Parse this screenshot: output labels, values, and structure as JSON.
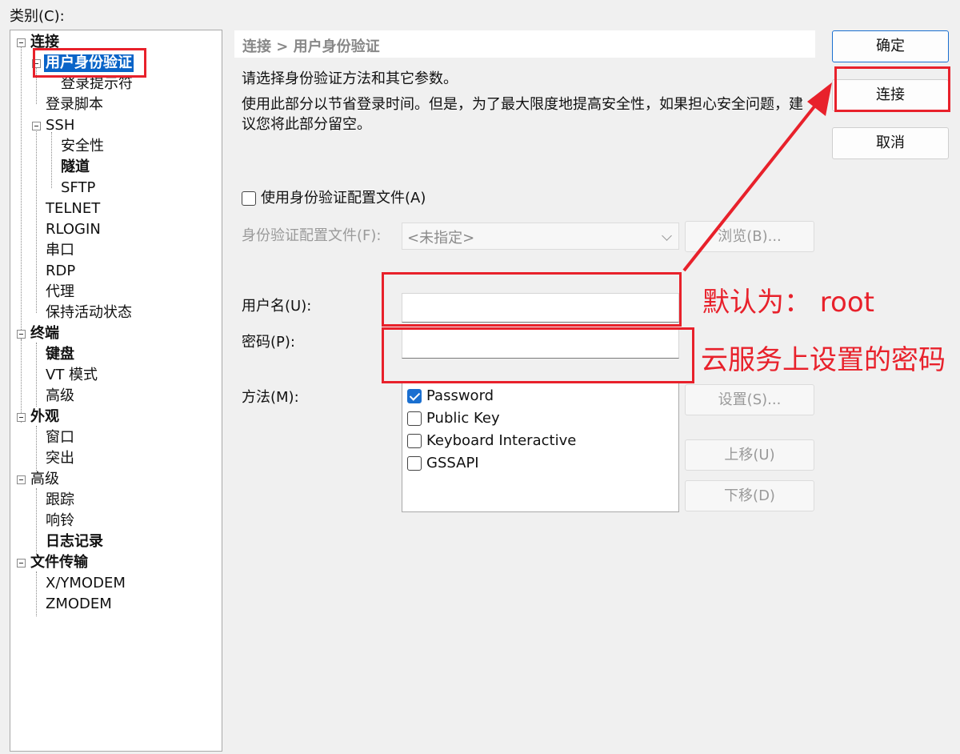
{
  "category_label": "类别(C):",
  "tree": [
    {
      "label": "连接",
      "bold": true
    },
    {
      "label": "用户身份验证",
      "bold": true,
      "selected": true
    },
    {
      "label": "登录提示符"
    },
    {
      "label": "登录脚本"
    },
    {
      "label": "SSH"
    },
    {
      "label": "安全性"
    },
    {
      "label": "隧道",
      "bold": true
    },
    {
      "label": "SFTP"
    },
    {
      "label": "TELNET"
    },
    {
      "label": "RLOGIN"
    },
    {
      "label": "串口"
    },
    {
      "label": "RDP"
    },
    {
      "label": "代理"
    },
    {
      "label": "保持活动状态"
    },
    {
      "label": "终端",
      "bold": true
    },
    {
      "label": "键盘",
      "bold": true
    },
    {
      "label": "VT 模式"
    },
    {
      "label": "高级"
    },
    {
      "label": "外观",
      "bold": true
    },
    {
      "label": "窗口"
    },
    {
      "label": "突出"
    },
    {
      "label": "高级"
    },
    {
      "label": "跟踪"
    },
    {
      "label": "响铃"
    },
    {
      "label": "日志记录",
      "bold": true
    },
    {
      "label": "文件传输",
      "bold": true
    },
    {
      "label": "X/YMODEM"
    },
    {
      "label": "ZMODEM"
    }
  ],
  "header": {
    "breadcrumb": "连接 > 用户身份验证"
  },
  "intro": {
    "line1": "请选择身份验证方法和其它参数。",
    "line2a": "使用此部分以节省登录时间。但是，为了最大限度地提高安全性，如果担心安全问题，建",
    "line2b": "议您将此部分留空。"
  },
  "use_profile": {
    "label": "使用身份验证配置文件(A)",
    "checked": false
  },
  "profile": {
    "label": "身份验证配置文件(F):",
    "value": "<未指定>",
    "browse_label": "浏览(B)..."
  },
  "username": {
    "label": "用户名(U):",
    "value": ""
  },
  "password": {
    "label": "密码(P):",
    "value": ""
  },
  "method": {
    "label": "方法(M):",
    "items": [
      {
        "label": "Password",
        "checked": true
      },
      {
        "label": "Public Key",
        "checked": false
      },
      {
        "label": "Keyboard Interactive",
        "checked": false
      },
      {
        "label": "GSSAPI",
        "checked": false
      }
    ],
    "settings_label": "设置(S)...",
    "move_up_label": "上移(U)",
    "move_down_label": "下移(D)"
  },
  "buttons": {
    "ok": "确定",
    "connect": "连接",
    "cancel": "取消"
  },
  "annotations": {
    "username_note": "默认为：  root",
    "password_note": "云服务上设置的密码"
  },
  "colors": {
    "accent": "#1a6fd0",
    "selection": "#0a64c8",
    "annotation": "#e8212b"
  }
}
